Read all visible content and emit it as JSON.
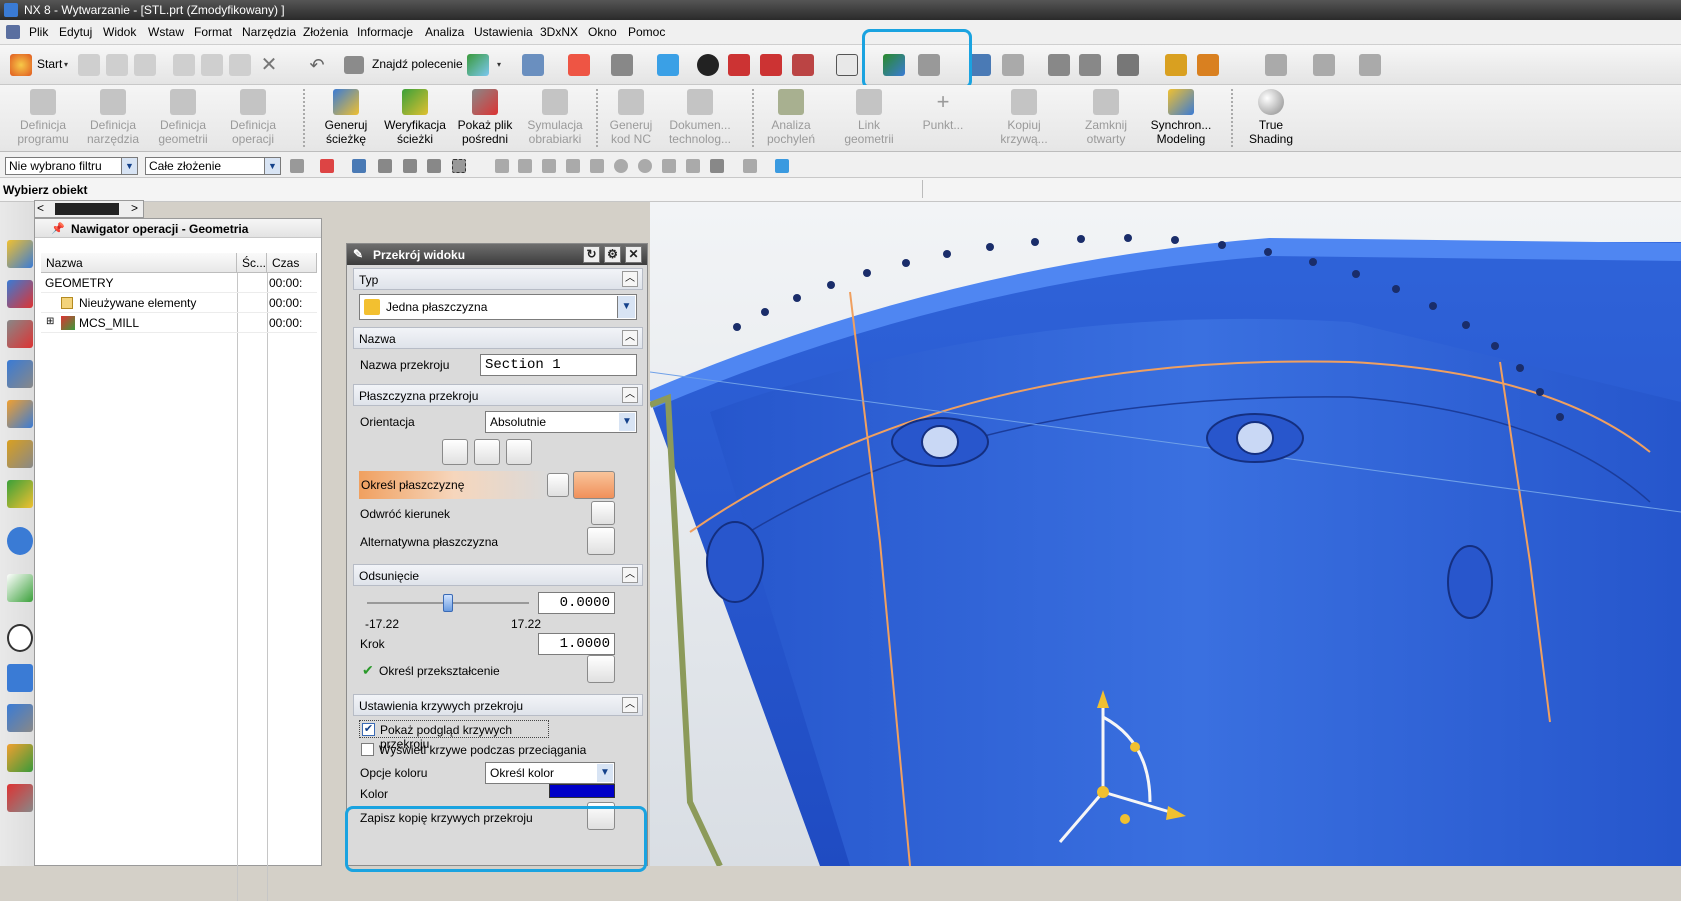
{
  "window": {
    "title": "NX 8 - Wytwarzanie - [STL.prt (Zmodyfikowany) ]"
  },
  "menu": [
    "Plik",
    "Edytuj",
    "Widok",
    "Wstaw",
    "Format",
    "Narzędzia",
    "Złożenia",
    "Informacje",
    "Analiza",
    "Ustawienia",
    "3DxNX",
    "Okno",
    "Pomoc"
  ],
  "toolbar": {
    "start": "Start",
    "find": "Znajdź polecenie"
  },
  "ribbon": [
    {
      "l1": "Definicja",
      "l2": "programu"
    },
    {
      "l1": "Definicja",
      "l2": "narzędzia"
    },
    {
      "l1": "Definicja",
      "l2": "geometrii"
    },
    {
      "l1": "Definicja",
      "l2": "operacji"
    },
    {
      "l1": "Generuj",
      "l2": "ścieżkę"
    },
    {
      "l1": "Weryfikacja",
      "l2": "ścieżki"
    },
    {
      "l1": "Pokaż plik",
      "l2": "pośredni"
    },
    {
      "l1": "Symulacja",
      "l2": "obrabiarki"
    },
    {
      "l1": "Generuj",
      "l2": "kod NC"
    },
    {
      "l1": "Dokumen...",
      "l2": "technolog..."
    },
    {
      "l1": "Analiza",
      "l2": "pochyleń"
    },
    {
      "l1": "Link",
      "l2": "geometrii"
    },
    {
      "l1": "Punkt...",
      "l2": ""
    },
    {
      "l1": "Kopiuj",
      "l2": "krzywą..."
    },
    {
      "l1": "Zamknij",
      "l2": "otwarty"
    },
    {
      "l1": "Synchron...",
      "l2": "Modeling"
    },
    {
      "l1": "True",
      "l2": "Shading"
    }
  ],
  "filters": {
    "type": "Nie wybrano filtru",
    "scope": "Całe złożenie"
  },
  "cue": "Wybierz obiekt",
  "navigator": {
    "title": "Nawigator operacji - Geometria",
    "columns": [
      "Nazwa",
      "Śc...",
      "Czas"
    ],
    "rows": [
      {
        "name": "GEOMETRY",
        "time": "00:00:"
      },
      {
        "name": "Nieużywane elementy",
        "time": "00:00:"
      },
      {
        "name": "MCS_MILL",
        "time": "00:00:"
      }
    ]
  },
  "dialog": {
    "title": "Przekrój widoku",
    "typ_group": "Typ",
    "typ_value": "Jedna płaszczyzna",
    "nazwa_group": "Nazwa",
    "nazwa_label": "Nazwa przekroju",
    "nazwa_value": "Section 1",
    "plane_group": "Płaszczyzna przekroju",
    "orient_label": "Orientacja",
    "orient_value": "Absolutnie",
    "specify_plane": "Określ płaszczyznę",
    "reverse": "Odwróć kierunek",
    "alt_plane": "Alternatywna płaszczyzna",
    "offset_group": "Odsunięcie",
    "offset_value": "0.0000",
    "slider_min": "-17.22",
    "slider_max": "17.22",
    "slider_pos": 0.5,
    "step_label": "Krok",
    "step_value": "1.0000",
    "transform": "Określ przekształcenie",
    "curve_group": "Ustawienia krzywych przekroju",
    "cb1": "Pokaż podgląd krzywych przekroju",
    "cb2": "Wyświetl krzywe podczas przeciągania",
    "color_opt_label": "Opcje koloru",
    "color_opt_value": "Określ kolor",
    "color_label": "Kolor",
    "color_value": "#0000c8",
    "save_copy": "Zapisz kopię krzywych przekroju"
  },
  "colors": {
    "highlight": "#1aa3e0",
    "model": "#2d5fd6",
    "section": "#8c9a5a",
    "accent_orange": "#f0a060"
  }
}
